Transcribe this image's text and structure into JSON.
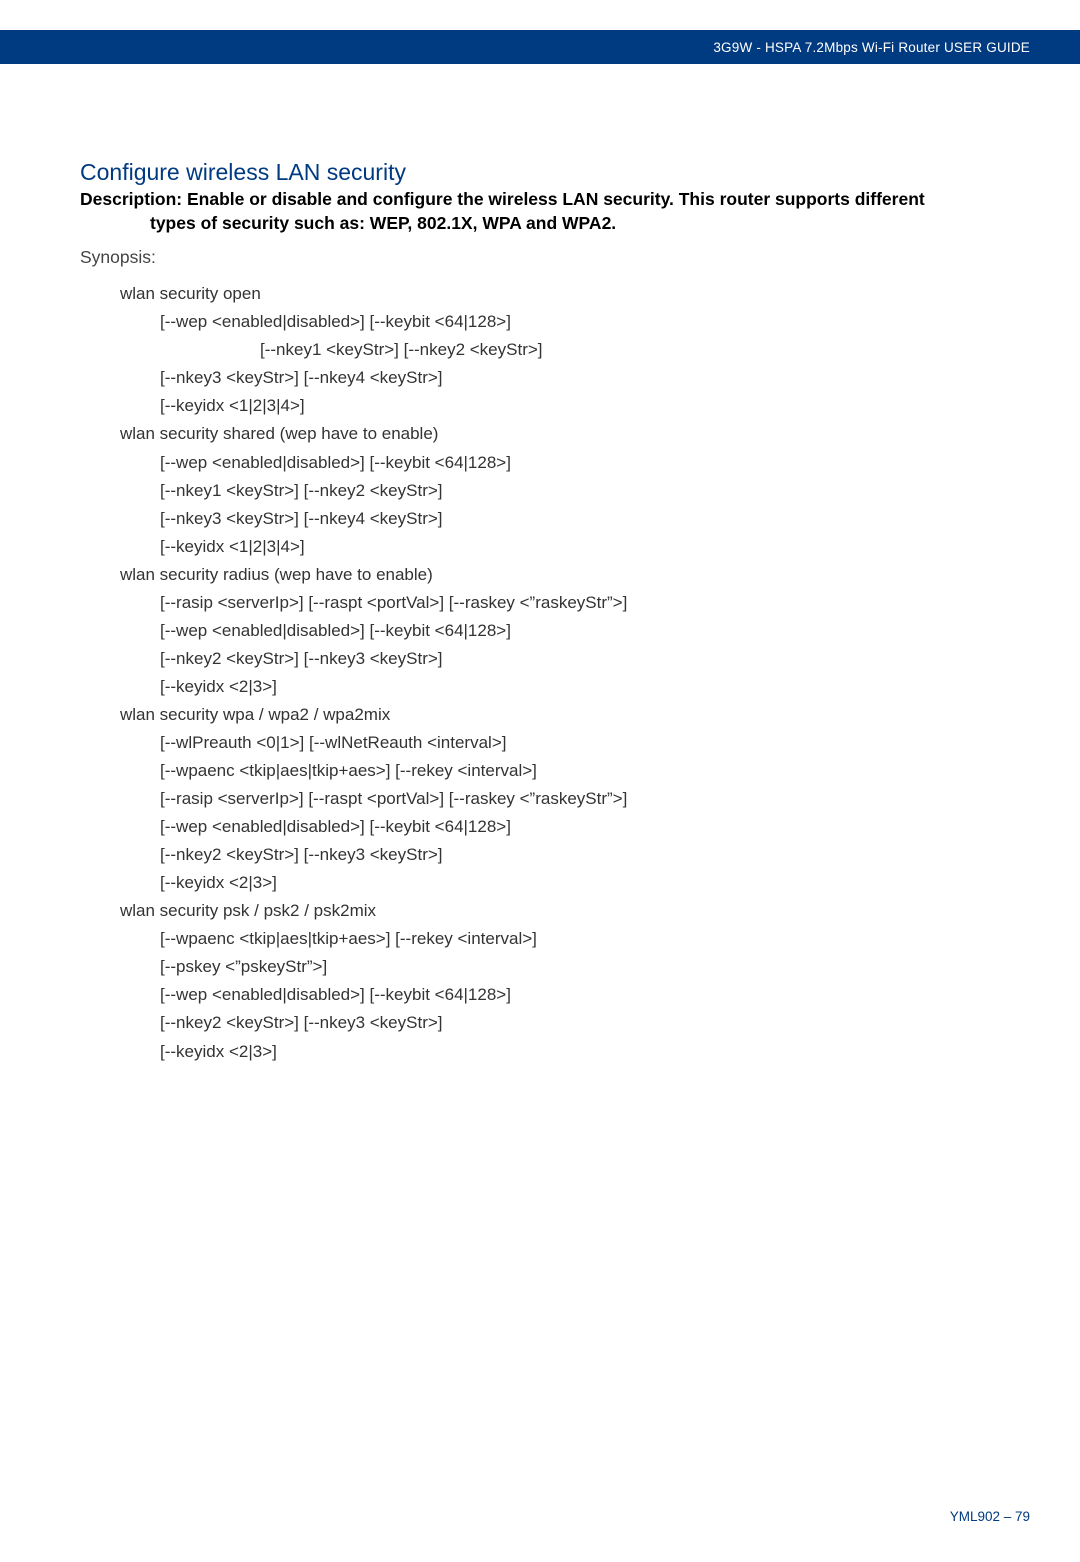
{
  "header": {
    "text": "3G9W - HSPA 7.2Mbps Wi-Fi Router USER GUIDE"
  },
  "title": "Configure wireless LAN security",
  "description": {
    "label": "Description:",
    "line1": "Enable or disable and configure the wireless LAN security. This router supports different",
    "line2": "types of security such as: WEP, 802.1X, WPA and WPA2."
  },
  "synopsis_label": "Synopsis:",
  "lines": [
    {
      "cls": "cmd",
      "t": "wlan security open"
    },
    {
      "cls": "opt",
      "t": "[--wep <enabled|disabled>] [--keybit <64|128>]"
    },
    {
      "cls": "opt-deep",
      "t": "[--nkey1 <keyStr>] [--nkey2 <keyStr>]"
    },
    {
      "cls": "opt",
      "t": "[--nkey3 <keyStr>] [--nkey4 <keyStr>]"
    },
    {
      "cls": "opt",
      "t": "[--keyidx <1|2|3|4>]"
    },
    {
      "cls": "cmd",
      "t": "wlan security shared (wep have to enable)"
    },
    {
      "cls": "opt",
      "t": "[--wep <enabled|disabled>] [--keybit <64|128>]"
    },
    {
      "cls": "opt",
      "t": "[--nkey1 <keyStr>] [--nkey2 <keyStr>]"
    },
    {
      "cls": "opt",
      "t": "[--nkey3 <keyStr>] [--nkey4 <keyStr>]"
    },
    {
      "cls": "opt",
      "t": "[--keyidx <1|2|3|4>]"
    },
    {
      "cls": "cmd",
      "t": "wlan security radius (wep have to enable)"
    },
    {
      "cls": "opt",
      "t": "[--rasip <serverIp>] [--raspt <portVal>] [--raskey <”raskeyStr”>]"
    },
    {
      "cls": "opt",
      "t": "[--wep <enabled|disabled>] [--keybit <64|128>]"
    },
    {
      "cls": "opt",
      "t": "[--nkey2 <keyStr>] [--nkey3 <keyStr>]"
    },
    {
      "cls": "opt",
      "t": "[--keyidx <2|3>]"
    },
    {
      "cls": "cmd",
      "t": "wlan security wpa / wpa2 / wpa2mix"
    },
    {
      "cls": "opt",
      "t": "[--wlPreauth <0|1>] [--wlNetReauth <interval>]"
    },
    {
      "cls": "opt",
      "t": "[--wpaenc <tkip|aes|tkip+aes>] [--rekey <interval>]"
    },
    {
      "cls": "opt",
      "t": "[--rasip <serverIp>] [--raspt <portVal>] [--raskey <”raskeyStr”>]"
    },
    {
      "cls": "opt",
      "t": "[--wep <enabled|disabled>] [--keybit <64|128>]"
    },
    {
      "cls": "opt",
      "t": "[--nkey2 <keyStr>] [--nkey3 <keyStr>]"
    },
    {
      "cls": "opt",
      "t": "[--keyidx <2|3>]"
    },
    {
      "cls": "cmd",
      "t": "wlan security psk / psk2 / psk2mix"
    },
    {
      "cls": "opt",
      "t": "[--wpaenc <tkip|aes|tkip+aes>] [--rekey <interval>]"
    },
    {
      "cls": "opt",
      "t": "[--pskey <”pskeyStr”>]"
    },
    {
      "cls": "opt",
      "t": "[--wep <enabled|disabled>] [--keybit <64|128>]"
    },
    {
      "cls": "opt",
      "t": "[--nkey2 <keyStr>] [--nkey3 <keyStr>]"
    },
    {
      "cls": "opt",
      "t": "[--keyidx <2|3>]"
    }
  ],
  "footer": "YML902 – 79"
}
